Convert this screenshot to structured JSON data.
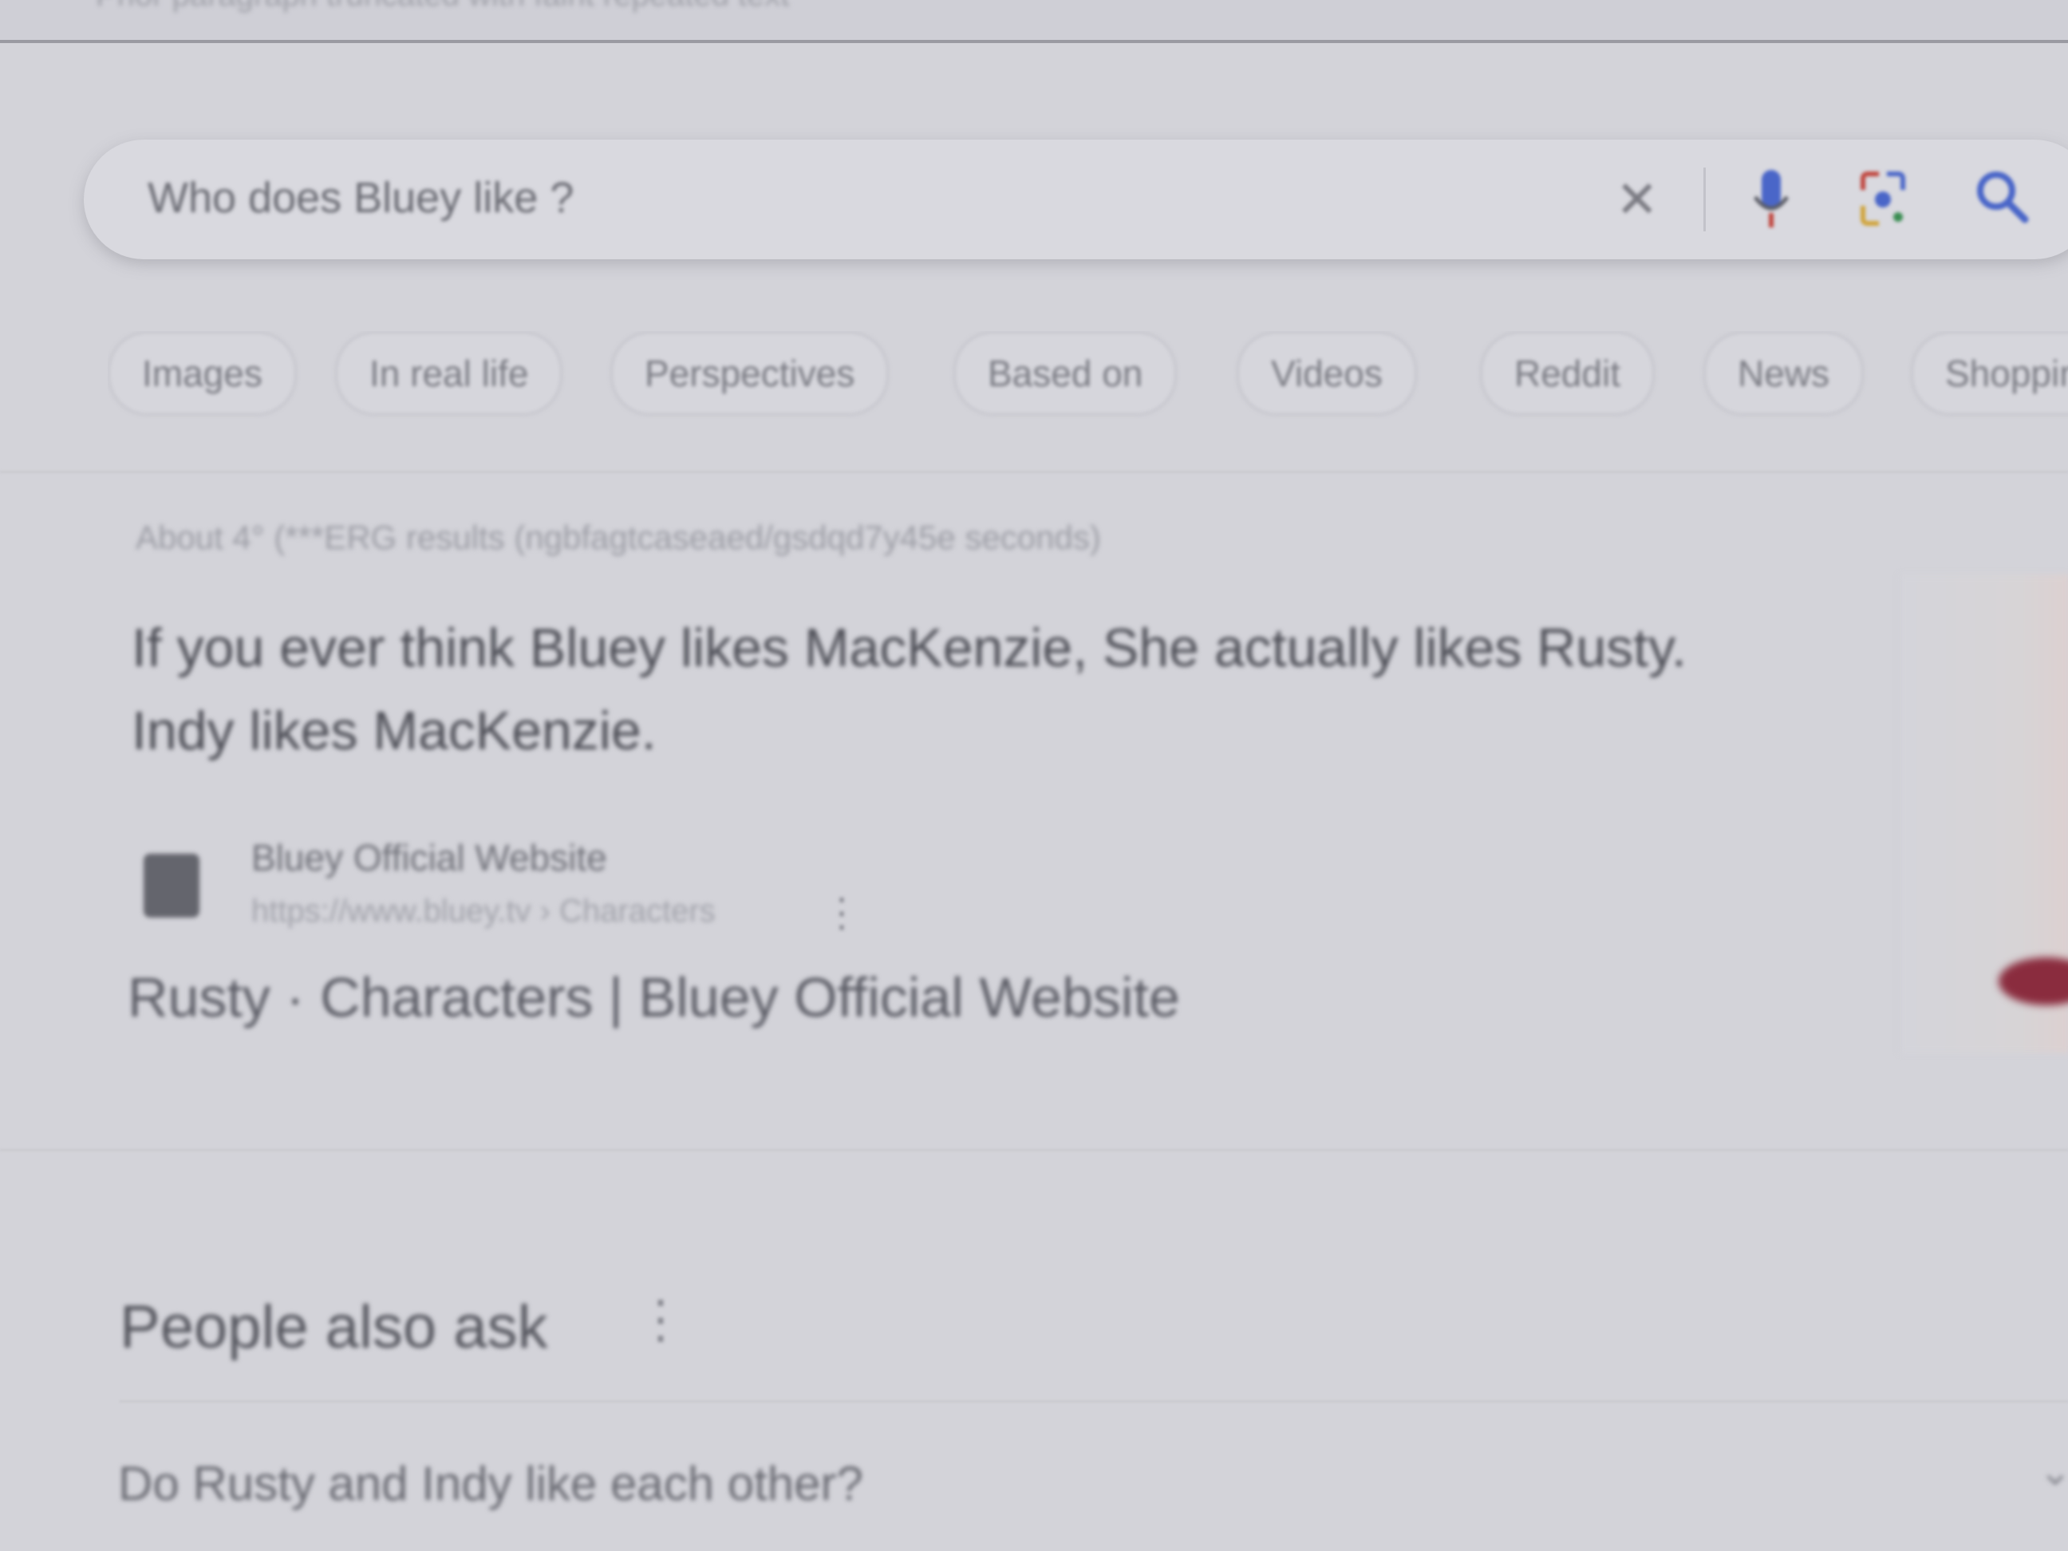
{
  "top_bar": {
    "text": "Prior paragraph truncated with faint repeated text"
  },
  "search": {
    "query": "Who does Bluey like ?",
    "clear_icon": "close-icon",
    "voice_icon": "microphone-icon",
    "lens_icon": "camera-lens-icon",
    "submit_icon": "search-icon"
  },
  "chips": [
    "Images",
    "In real life",
    "Perspectives",
    "Based on",
    "Videos",
    "Reddit",
    "News",
    "Shopping"
  ],
  "results_stats": "About 4° (***ERG results (ngbfagtcaseaed/gsdqd7y45e seconds)",
  "snippet": {
    "line1": "If you ever think Bluey likes MacKenzie, She actually likes Rusty.",
    "line2": "Indy likes MacKenzie."
  },
  "source": {
    "name": "Bluey Official Website",
    "url": "https://www.bluey.tv › Characters",
    "more": "⋮"
  },
  "result_link": "Rusty · Characters | Bluey Official Website",
  "people_also_ask": {
    "title": "People also ask",
    "menu": "⋮",
    "questions": [
      "Do Rusty and Indy like each other?"
    ]
  },
  "colors": {
    "background": "#d3d3d9",
    "accent_image": "#8a2c3e"
  }
}
